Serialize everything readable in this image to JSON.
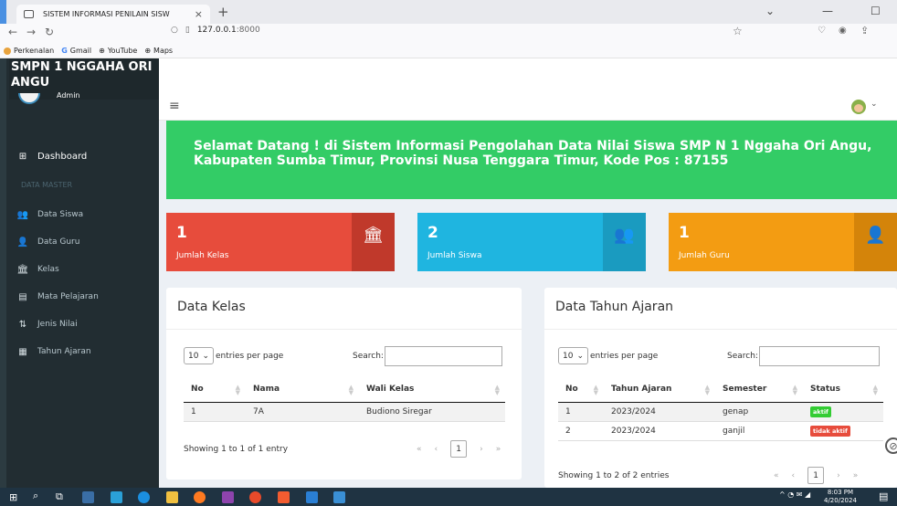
{
  "browser": {
    "tab_title": "SISTEM INFORMASI PENILAIN SISW",
    "tab_close": "×",
    "new_tab": "+",
    "url": "127.0.0.1",
    "url_port": ":8000",
    "bookmarks": [
      "Perkenalan",
      "Gmail",
      "YouTube",
      "Maps"
    ]
  },
  "sidebar": {
    "brand": "SMPN 1 NGGAHA ORI ANGU",
    "user_label": "Admin",
    "dashboard": "Dashboard",
    "header": "DATA MASTER",
    "items": [
      "Data Siswa",
      "Data Guru",
      "Kelas",
      "Mata Pelajaran",
      "Jenis Nilai",
      "Tahun Ajaran"
    ]
  },
  "welcome": {
    "line1": "Selamat Datang ! di Sistem Informasi Pengolahan Data Nilai Siswa SMP N 1 Nggaha Ori Angu,",
    "line2": "Kabupaten Sumba Timur, Provinsi Nusa Tenggara Timur, Kode Pos : 87155"
  },
  "stats": [
    {
      "value": "1",
      "label": "Jumlah Kelas",
      "color": "#e74c3c",
      "icon_bg": "#c0392b"
    },
    {
      "value": "2",
      "label": "Jumlah Siswa",
      "color": "#1fb5e0",
      "icon_bg": "#1a9bc0"
    },
    {
      "value": "1",
      "label": "Jumlah Guru",
      "color": "#f39c12",
      "icon_bg": "#d4840a"
    }
  ],
  "kelas_panel": {
    "title": "Data Kelas",
    "length_value": "10",
    "length_suffix": "entries per page",
    "search_label": "Search:",
    "headers": [
      "No",
      "Nama",
      "Wali Kelas"
    ],
    "rows": [
      [
        "1",
        "7A",
        "Budiono Siregar"
      ]
    ],
    "info": "Showing 1 to 1 of 1 entry",
    "page": "1"
  },
  "tahun_panel": {
    "title": "Data Tahun Ajaran",
    "length_value": "10",
    "length_suffix": "entries per page",
    "search_label": "Search:",
    "headers": [
      "No",
      "Tahun Ajaran",
      "Semester",
      "Status"
    ],
    "rows": [
      {
        "no": "1",
        "tahun": "2023/2024",
        "semester": "genap",
        "status": "aktif",
        "status_color": "#33cc33"
      },
      {
        "no": "2",
        "tahun": "2023/2024",
        "semester": "ganjil",
        "status": "tidak aktif",
        "status_color": "#e74c3c"
      }
    ],
    "info": "Showing 1 to 2 of 2 entries",
    "page": "1"
  },
  "taskbar": {
    "time": "8:03 PM",
    "date": "4/20/2024"
  }
}
